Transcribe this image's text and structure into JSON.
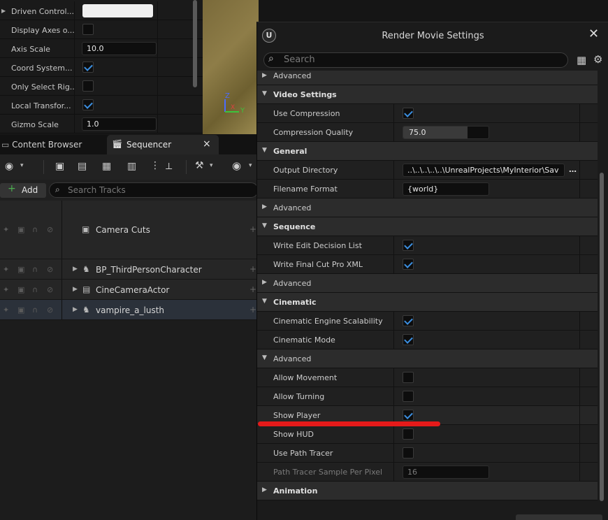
{
  "details": {
    "rows": [
      {
        "label": "Driven Control...",
        "type": "swatch"
      },
      {
        "label": "Display Axes o...",
        "type": "check",
        "checked": false
      },
      {
        "label": "Axis Scale",
        "type": "number",
        "value": "10.0"
      },
      {
        "label": "Coord System...",
        "type": "check",
        "checked": true
      },
      {
        "label": "Only Select Rig...",
        "type": "check",
        "checked": false
      },
      {
        "label": "Local Transfor...",
        "type": "check",
        "checked": true
      },
      {
        "label": "Gizmo Scale",
        "type": "number",
        "value": "1.0"
      }
    ]
  },
  "viewport": {
    "axis_z": "Z",
    "axis_x": "X",
    "axis_y": "Y"
  },
  "tabs": {
    "content_browser": "Content Browser",
    "sequencer": "Sequencer",
    "close": "×"
  },
  "sequencer": {
    "add_label": "Add",
    "search_placeholder": "Search Tracks",
    "tracks": [
      {
        "name": "Camera Cuts",
        "icon": "camera-cuts-icon"
      },
      {
        "name": "BP_ThirdPersonCharacter",
        "icon": "character-icon"
      },
      {
        "name": "CineCameraActor",
        "icon": "camera-actor-icon"
      },
      {
        "name": "vampire_a_lusth",
        "icon": "character-icon"
      }
    ]
  },
  "rms": {
    "title": "Render Movie Settings",
    "search_placeholder": "Search",
    "rows": [
      {
        "label": "Advanced",
        "kind": "collapsed"
      },
      {
        "label": "Video Settings",
        "kind": "category"
      },
      {
        "label": "Use Compression",
        "kind": "check",
        "checked": true
      },
      {
        "label": "Compression Quality",
        "kind": "slider",
        "value": "75.0",
        "fraction": 0.75
      },
      {
        "label": "General",
        "kind": "category"
      },
      {
        "label": "Output Directory",
        "kind": "text",
        "value": "..\\..\\..\\..\\..\\UnrealProjects\\MyInterior\\Sav"
      },
      {
        "label": "Filename Format",
        "kind": "text",
        "value": "{world}"
      },
      {
        "label": "Advanced",
        "kind": "collapsed"
      },
      {
        "label": "Sequence",
        "kind": "category"
      },
      {
        "label": "Write Edit Decision List",
        "kind": "check",
        "checked": true
      },
      {
        "label": "Write Final Cut Pro XML",
        "kind": "check",
        "checked": true
      },
      {
        "label": "Advanced",
        "kind": "collapsed"
      },
      {
        "label": "Cinematic",
        "kind": "category"
      },
      {
        "label": "Cinematic Engine Scalability",
        "kind": "check",
        "checked": true
      },
      {
        "label": "Cinematic Mode",
        "kind": "check",
        "checked": true
      },
      {
        "label": "Advanced",
        "kind": "subcategory"
      },
      {
        "label": "Allow Movement",
        "kind": "check",
        "checked": false
      },
      {
        "label": "Allow Turning",
        "kind": "check",
        "checked": false
      },
      {
        "label": "Show Player",
        "kind": "check",
        "checked": true
      },
      {
        "label": "Show HUD",
        "kind": "check",
        "checked": false
      },
      {
        "label": "Use Path Tracer",
        "kind": "check",
        "checked": false
      },
      {
        "label": "Path Tracer Sample Per Pixel",
        "kind": "number-dim",
        "value": "16"
      },
      {
        "label": "Animation",
        "kind": "collapsed-bold"
      }
    ]
  },
  "colors": {
    "accent": "#3b8edf",
    "highlight_line": "#e51a1a"
  }
}
